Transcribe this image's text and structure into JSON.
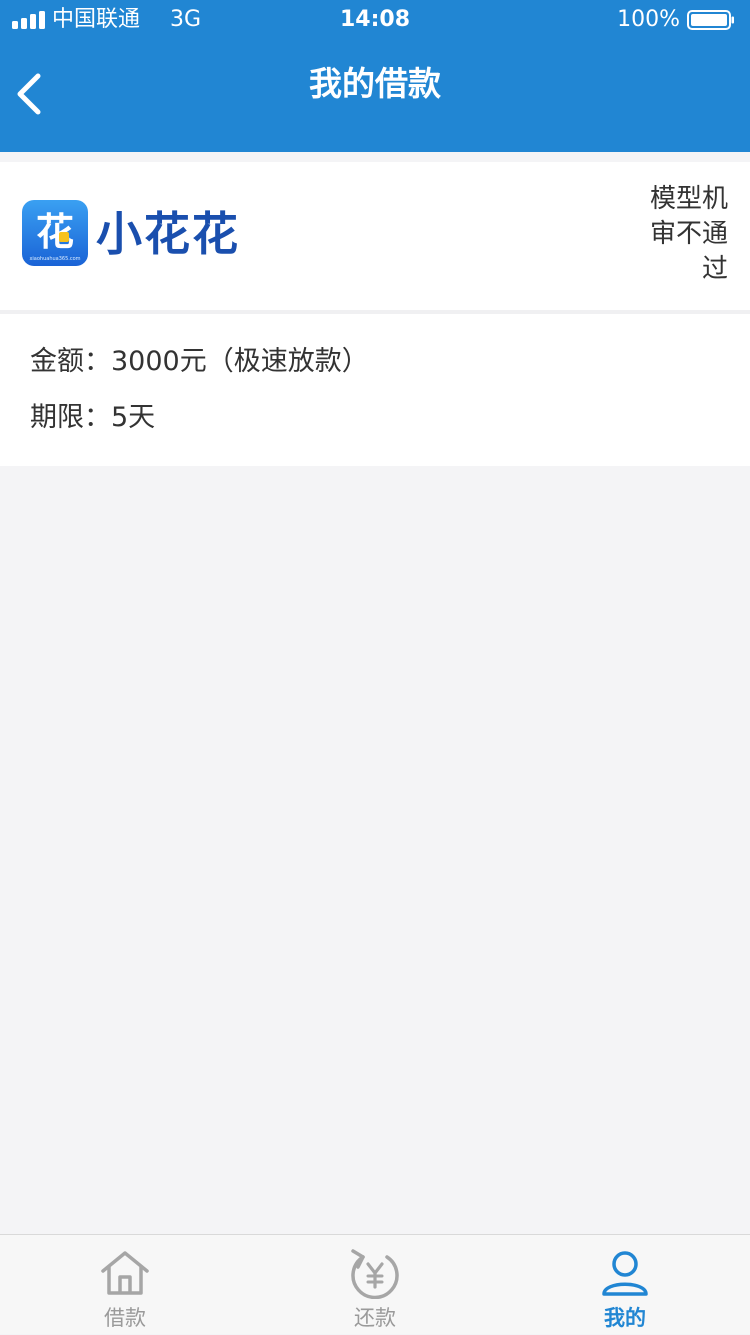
{
  "status_bar": {
    "carrier": "中国联通",
    "network": "3G",
    "time": "14:08",
    "battery": "100%"
  },
  "nav": {
    "title": "我的借款",
    "back_icon": "chevron-left-icon"
  },
  "loan": {
    "brand_name": "小花花",
    "logo_glyph": "花",
    "logo_url_text": "xiaohuahua365.com",
    "status": "模型机审不通过",
    "amount_text": "金额：3000元（极速放款）",
    "term_text": "期限：5天"
  },
  "tabs": [
    {
      "label": "借款",
      "icon": "home-icon",
      "active": false
    },
    {
      "label": "还款",
      "icon": "repay-yen-icon",
      "active": false
    },
    {
      "label": "我的",
      "icon": "user-icon",
      "active": true
    }
  ],
  "colors": {
    "primary": "#2186d3",
    "brand_text": "#1a4fae",
    "inactive": "#9a9a9a",
    "background": "#f4f4f6"
  }
}
